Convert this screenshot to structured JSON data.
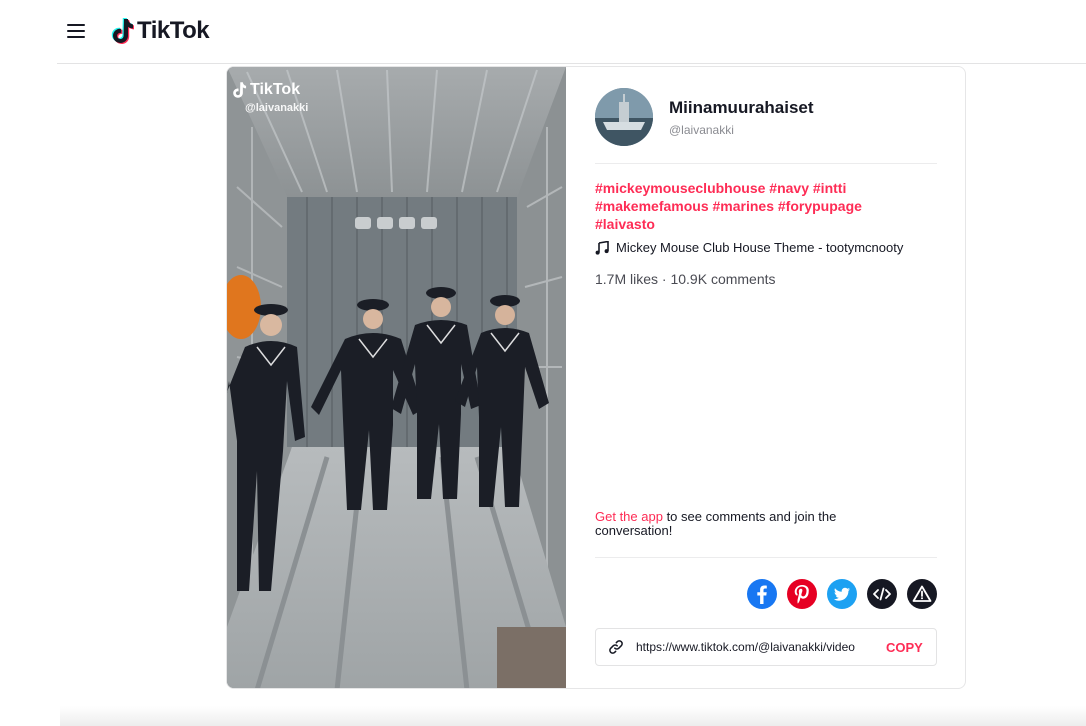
{
  "header": {
    "logo_text": "TikTok"
  },
  "video": {
    "watermark_logo": "TikTok",
    "watermark_user": "@laivanakki"
  },
  "author": {
    "display_name": "Miinamuurahaiset",
    "username": "@laivanakki"
  },
  "caption": {
    "hashtags": [
      "#mickeymouseclubhouse",
      "#navy",
      "#intti",
      "#makemefamous",
      "#marines",
      "#forypupage",
      "#laivasto"
    ]
  },
  "music": {
    "title": "Mickey Mouse Club House Theme - tootymcnooty"
  },
  "stats": {
    "text": "1.7M likes · 10.9K comments"
  },
  "get_app": {
    "link": "Get the app",
    "rest": " to see comments and join the conversation!"
  },
  "share": {
    "icons": [
      "facebook-icon",
      "pinterest-icon",
      "twitter-icon",
      "embed-icon",
      "report-icon"
    ]
  },
  "copy": {
    "url": "https://www.tiktok.com/@laivanakki/video",
    "label": "COPY"
  },
  "colors": {
    "accent": "#fe2c55",
    "facebook": "#1877f2",
    "pinterest": "#e60023",
    "twitter": "#1da1f2",
    "text": "#161823"
  }
}
